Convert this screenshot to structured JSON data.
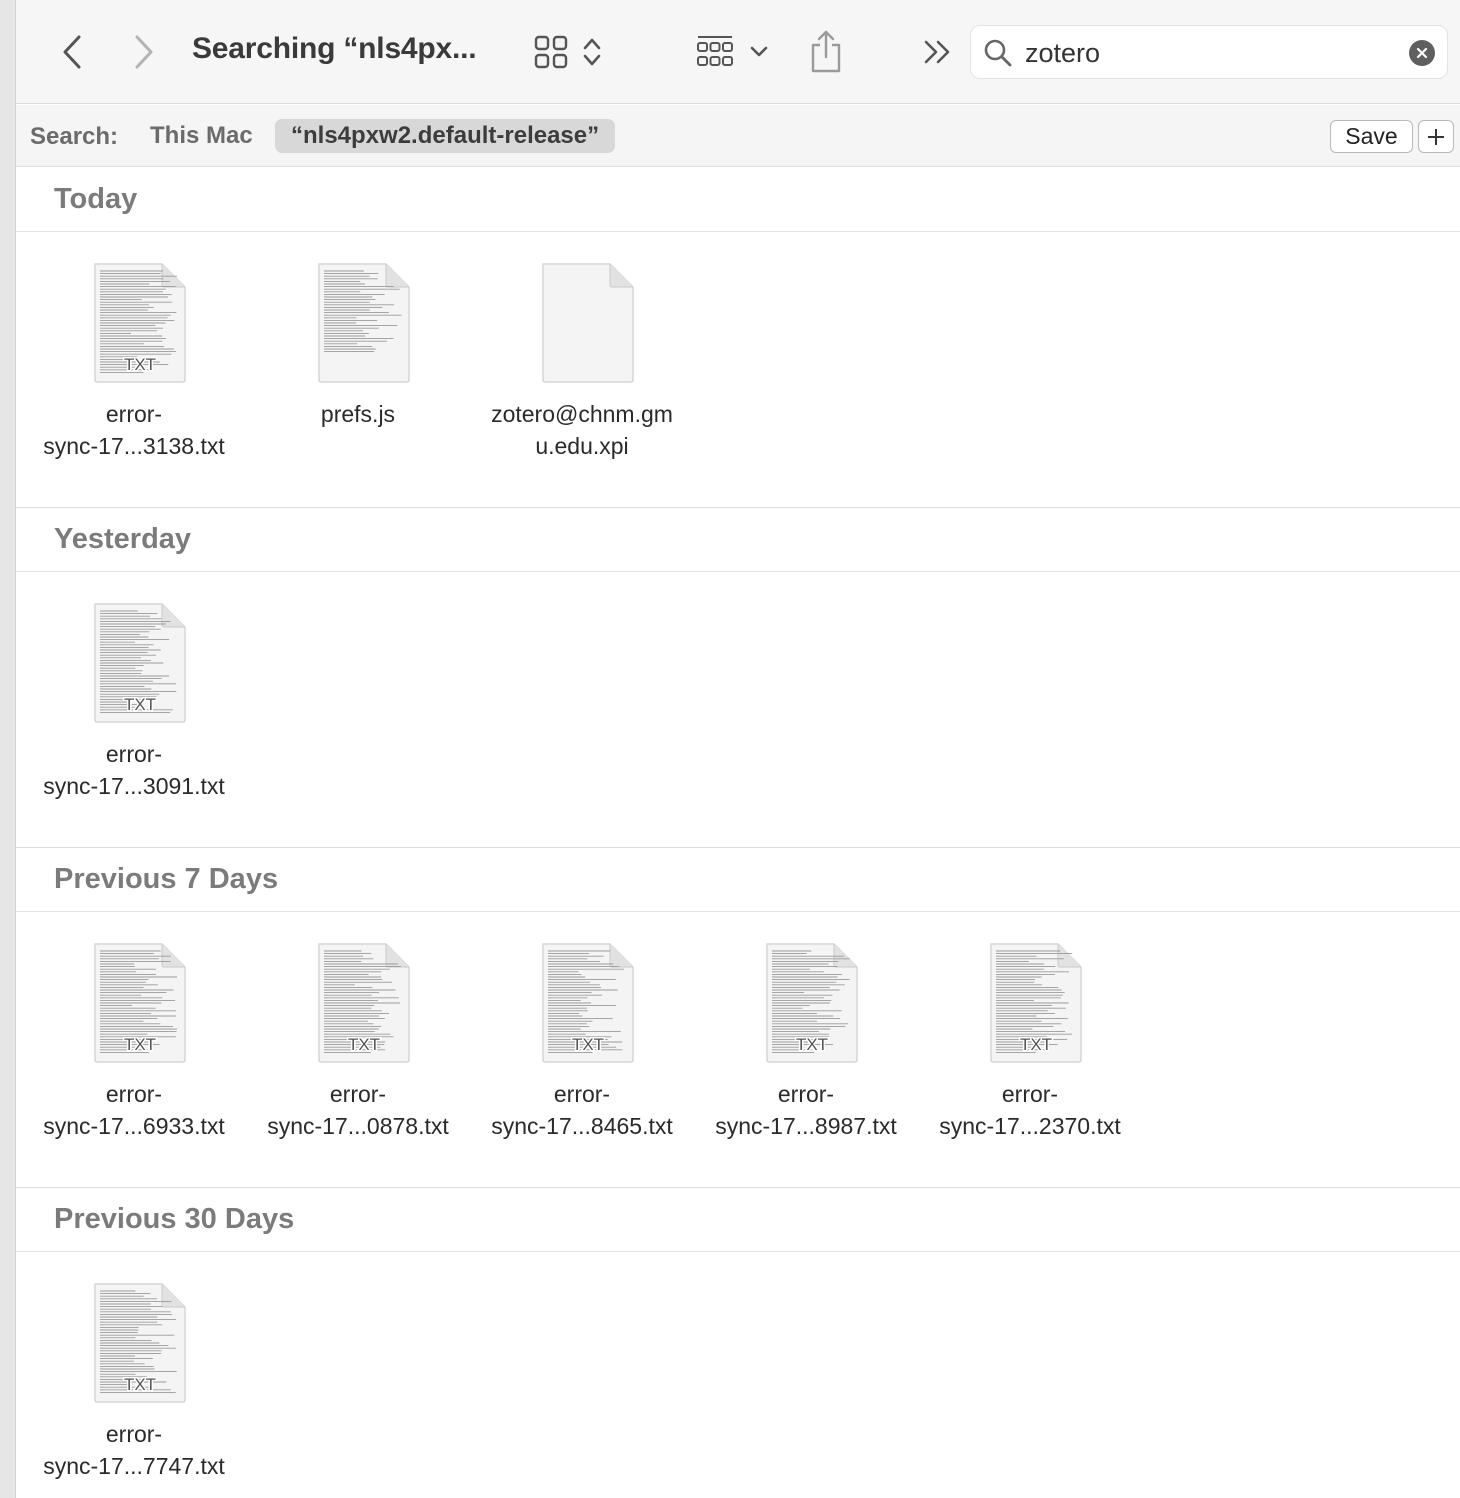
{
  "toolbar": {
    "title": "Searching “nls4px...",
    "search_value": "zotero"
  },
  "scope": {
    "label": "Search:",
    "this_mac": "This Mac",
    "token": "“nls4pxw2.default-release”",
    "save_label": "Save"
  },
  "sections": [
    {
      "title": "Today",
      "files": [
        {
          "line1": "error-",
          "line2": "sync-17...3138.txt",
          "kind": "txt",
          "badge": "TXT"
        },
        {
          "line1": "prefs.js",
          "line2": "",
          "kind": "js",
          "badge": ""
        },
        {
          "line1": "zotero@chnm.gm",
          "line2": "u.edu.xpi",
          "kind": "blank",
          "badge": ""
        }
      ]
    },
    {
      "title": "Yesterday",
      "files": [
        {
          "line1": "error-",
          "line2": "sync-17...3091.txt",
          "kind": "txt",
          "badge": "TXT"
        }
      ]
    },
    {
      "title": "Previous 7 Days",
      "files": [
        {
          "line1": "error-",
          "line2": "sync-17...6933.txt",
          "kind": "txt",
          "badge": "TXT"
        },
        {
          "line1": "error-",
          "line2": "sync-17...0878.txt",
          "kind": "txt",
          "badge": "TXT"
        },
        {
          "line1": "error-",
          "line2": "sync-17...8465.txt",
          "kind": "txt",
          "badge": "TXT"
        },
        {
          "line1": "error-",
          "line2": "sync-17...8987.txt",
          "kind": "txt",
          "badge": "TXT"
        },
        {
          "line1": "error-",
          "line2": "sync-17...2370.txt",
          "kind": "txt",
          "badge": "TXT"
        }
      ]
    },
    {
      "title": "Previous 30 Days",
      "files": [
        {
          "line1": "error-",
          "line2": "sync-17...7747.txt",
          "kind": "txt",
          "badge": "TXT"
        }
      ]
    }
  ]
}
